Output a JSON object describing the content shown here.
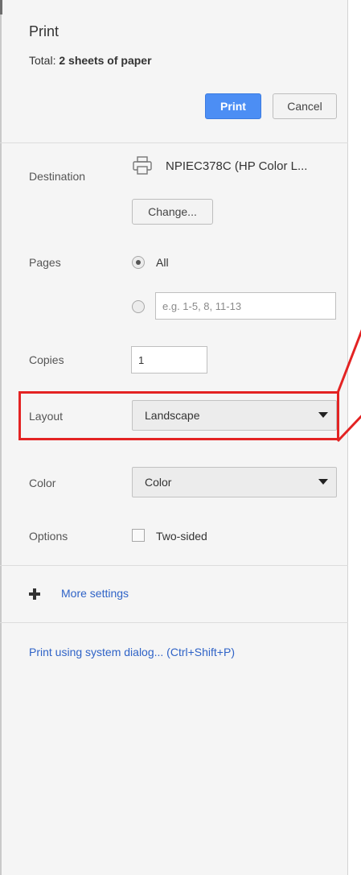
{
  "header": {
    "title": "Print",
    "summary_label": "Total:",
    "summary_value": "2 sheets of paper",
    "print_button": "Print",
    "cancel_button": "Cancel"
  },
  "destination": {
    "label": "Destination",
    "printer_name": "NPIEC378C (HP Color L...",
    "change_button": "Change...",
    "icon": "printer-icon"
  },
  "pages": {
    "label": "Pages",
    "all_option": "All",
    "all_selected": true,
    "custom_placeholder": "e.g. 1-5, 8, 11-13"
  },
  "copies": {
    "label": "Copies",
    "value": "1"
  },
  "layout": {
    "label": "Layout",
    "selected": "Landscape"
  },
  "color": {
    "label": "Color",
    "selected": "Color"
  },
  "options": {
    "label": "Options",
    "two_sided": "Two-sided",
    "two_sided_checked": false
  },
  "more_settings": {
    "label": "More settings",
    "icon": "plus-icon"
  },
  "system_dialog": {
    "label": "Print using system dialog... (Ctrl+Shift+P)"
  },
  "colors": {
    "primary_button": "#4c8ef4",
    "link": "#2f63c7",
    "annotation": "#e32323"
  }
}
